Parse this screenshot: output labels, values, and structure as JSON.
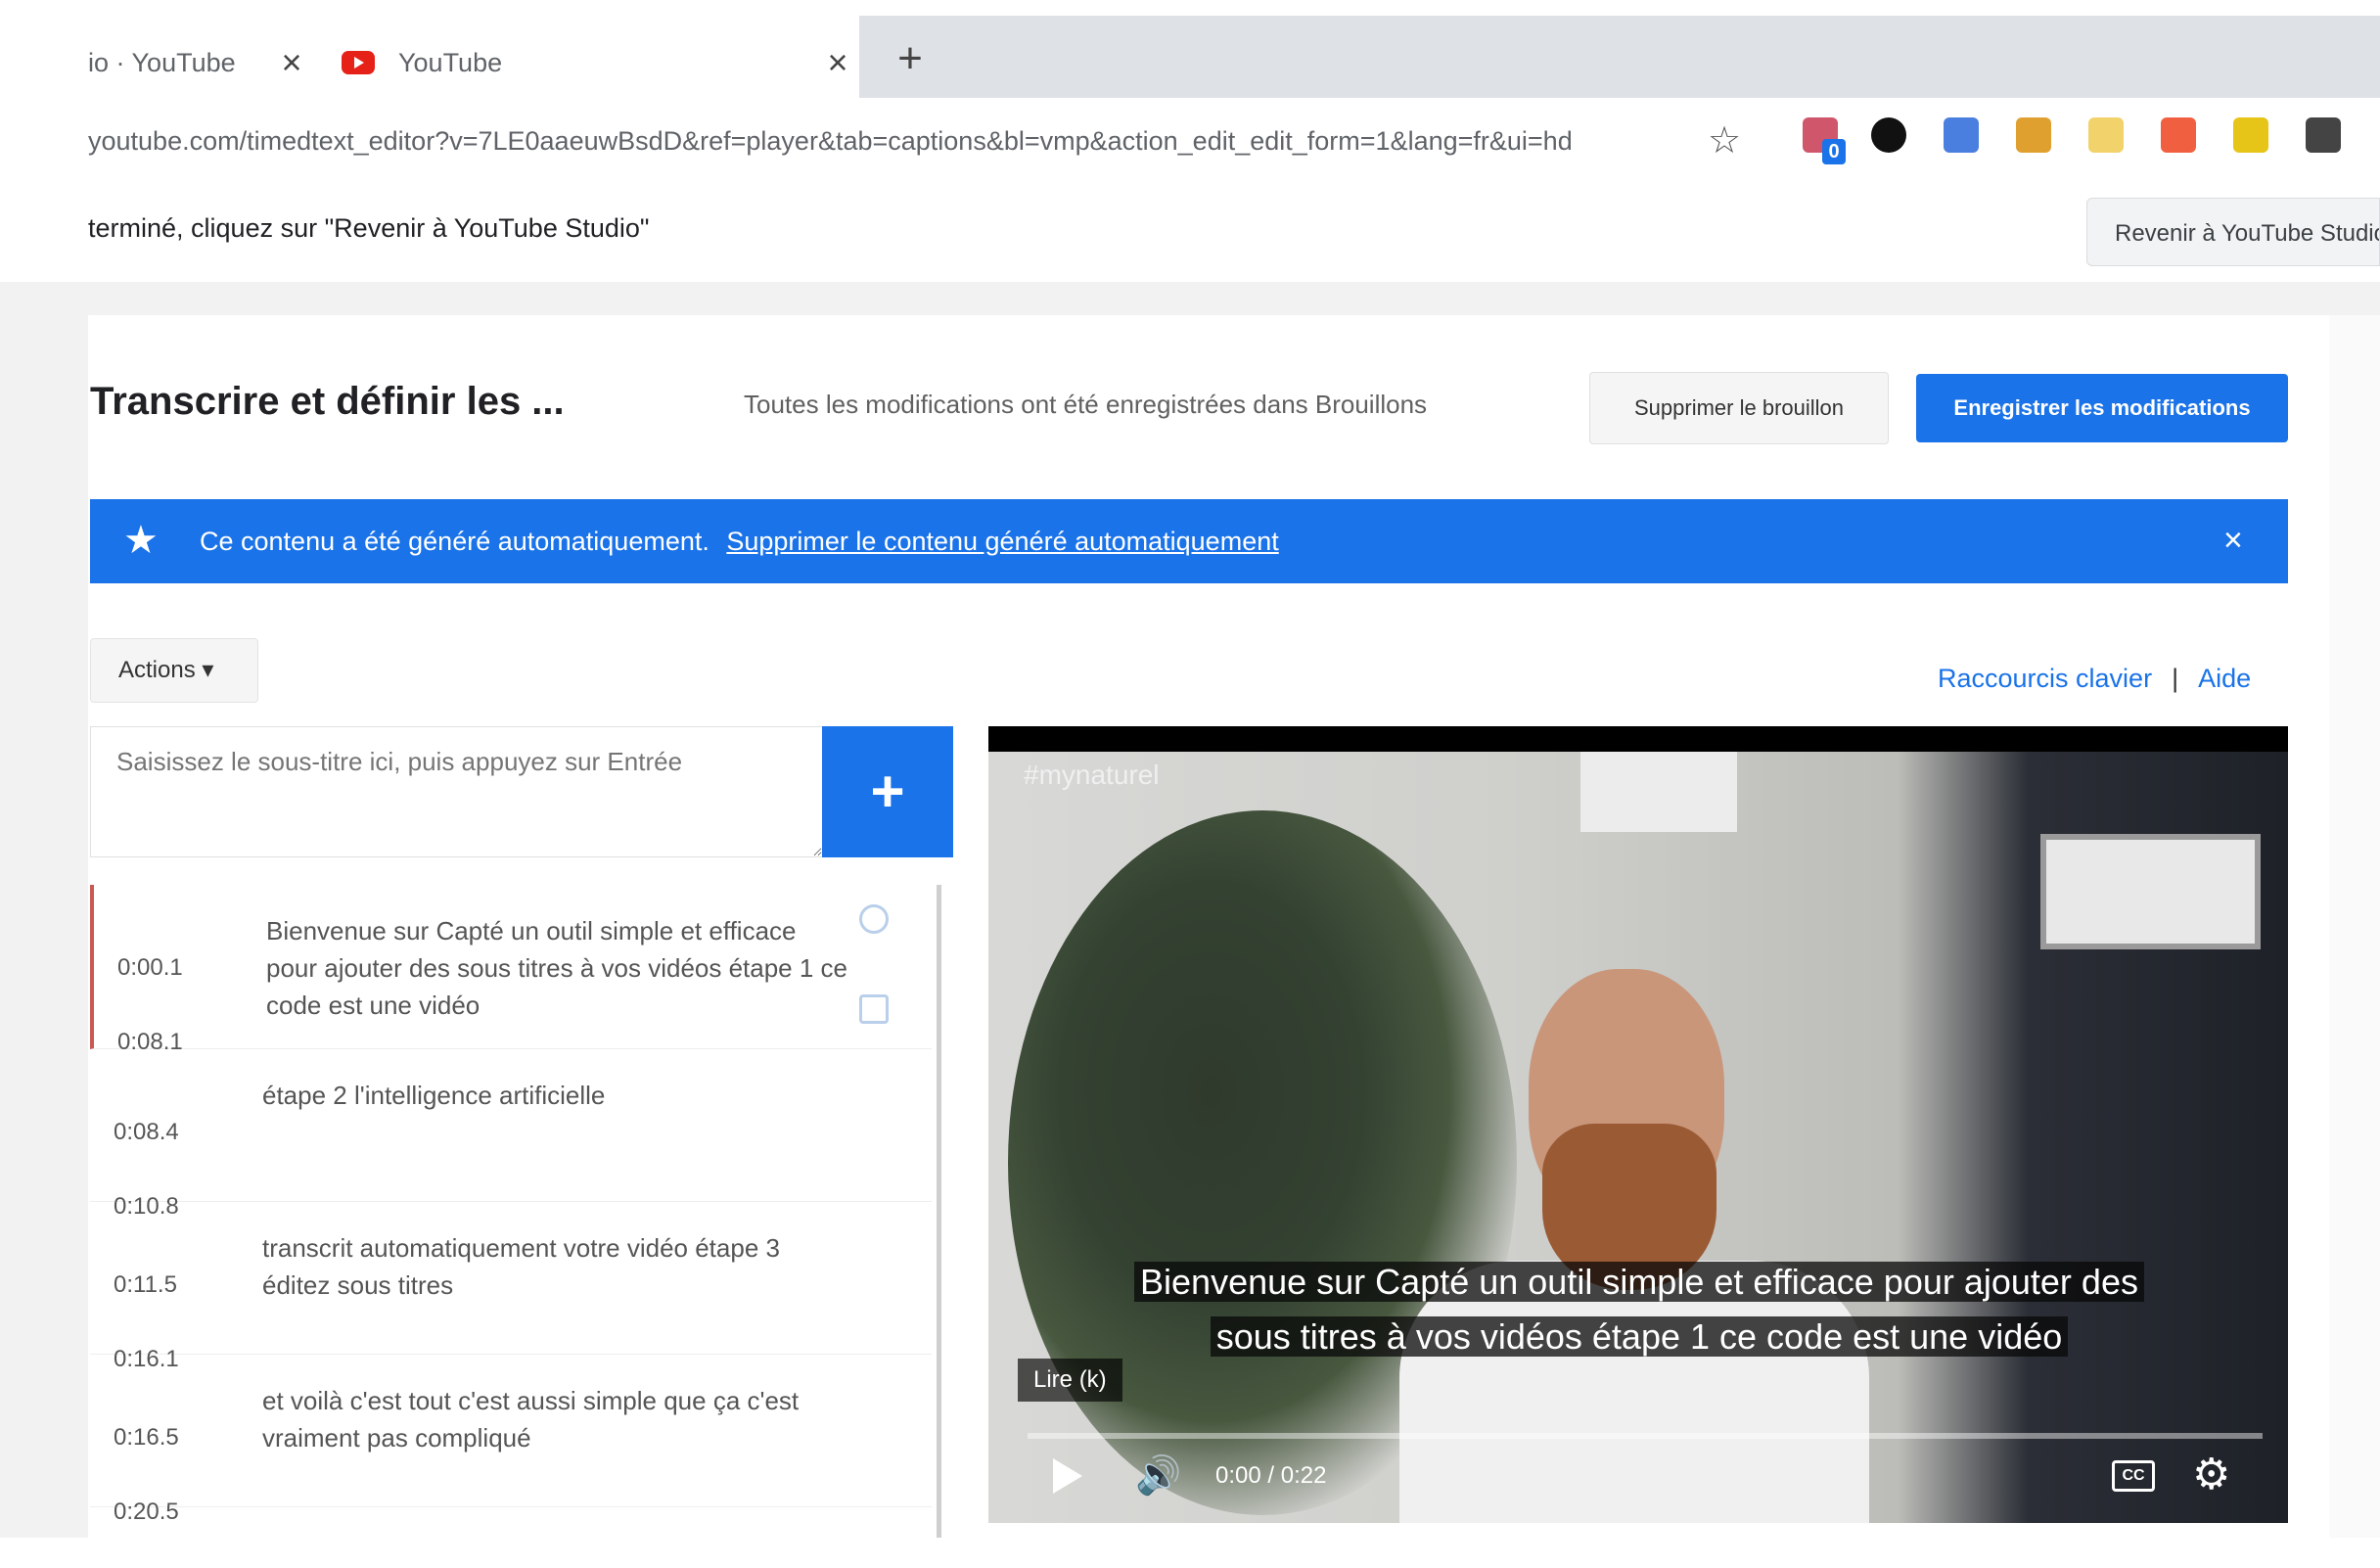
{
  "browser": {
    "tabs": [
      {
        "title": "io · YouTube",
        "active": false
      },
      {
        "title": "YouTube",
        "active": true
      }
    ],
    "tab_close_glyph": "×",
    "new_tab_glyph": "+",
    "url": "youtube.com/timedtext_editor?v=7LE0aaeuwBsdD&ref=player&tab=captions&bl=vmp&action_edit_edit_form=1&lang=fr&ui=hd",
    "star_glyph": "☆",
    "extension_badge_count": "0",
    "extensions": [
      {
        "name": "ext-octopus-icon",
        "color": "#d0566b"
      },
      {
        "name": "ext-pin-icon",
        "color": "#111111"
      },
      {
        "name": "ext-docs-icon",
        "color": "#4a7fe0"
      },
      {
        "name": "ext-chrome-icon",
        "color": "#e0a030"
      },
      {
        "name": "ext-bulb-icon",
        "color": "#f2d26a"
      },
      {
        "name": "ext-record-icon",
        "color": "#f06040"
      },
      {
        "name": "ext-check-icon",
        "color": "#e6c418"
      },
      {
        "name": "ext-menu-icon",
        "color": "#444444"
      }
    ]
  },
  "infobar": {
    "text": "terminé, cliquez sur \"Revenir à YouTube Studio\"",
    "back_button": "Revenir à YouTube Studio"
  },
  "editor": {
    "title": "Transcrire et définir les ...",
    "save_status": "Toutes les modifications ont été enregistrées dans Brouillons",
    "delete_draft": "Supprimer le brouillon",
    "publish": "Enregistrer les modifications"
  },
  "banner": {
    "star_glyph": "★",
    "text": "Ce contenu a été généré automatiquement.",
    "link": "Supprimer le contenu généré automatiquement",
    "close_glyph": "×",
    "color": "#1a73e8"
  },
  "actions": {
    "dropdown_label": "Actions ▾",
    "shortcuts_link": "Raccourcis clavier",
    "separator": "|",
    "help_link": "Aide"
  },
  "subtitle_input": {
    "placeholder": "Saisissez le sous-titre ici, puis appuyez sur Entrée",
    "add_glyph": "+"
  },
  "captions": [
    {
      "start": "0:00.1",
      "end": "0:08.1",
      "text": "Bienvenue sur Capté un outil simple et efficace pour ajouter des sous titres à vos vidéos étape 1 ce code est une vidéo",
      "active": true
    },
    {
      "start": "0:08.4",
      "end": "0:10.8",
      "text": "étape 2 l'intelligence artificielle",
      "active": false
    },
    {
      "start": "0:11.5",
      "end": "0:16.1",
      "text": "transcrit automatiquement votre vidéo étape 3 éditez sous titres",
      "active": false
    },
    {
      "start": "0:16.5",
      "end": "0:20.5",
      "text": "et voilà c'est tout c'est aussi simple que ça c'est vraiment pas compliqué",
      "active": false
    }
  ],
  "player": {
    "watermark": "#mynaturel",
    "overlay_caption": "Bienvenue sur Capté un outil simple et efficace pour ajouter des sous titres à vos vidéos étape 1 ce code est une vidéo",
    "language_badge": "Lire (k)",
    "time": "0:00 / 0:22",
    "progress": 0.0,
    "cc_label": "CC",
    "volume_glyph": "🔊",
    "settings_glyph": "⚙"
  }
}
